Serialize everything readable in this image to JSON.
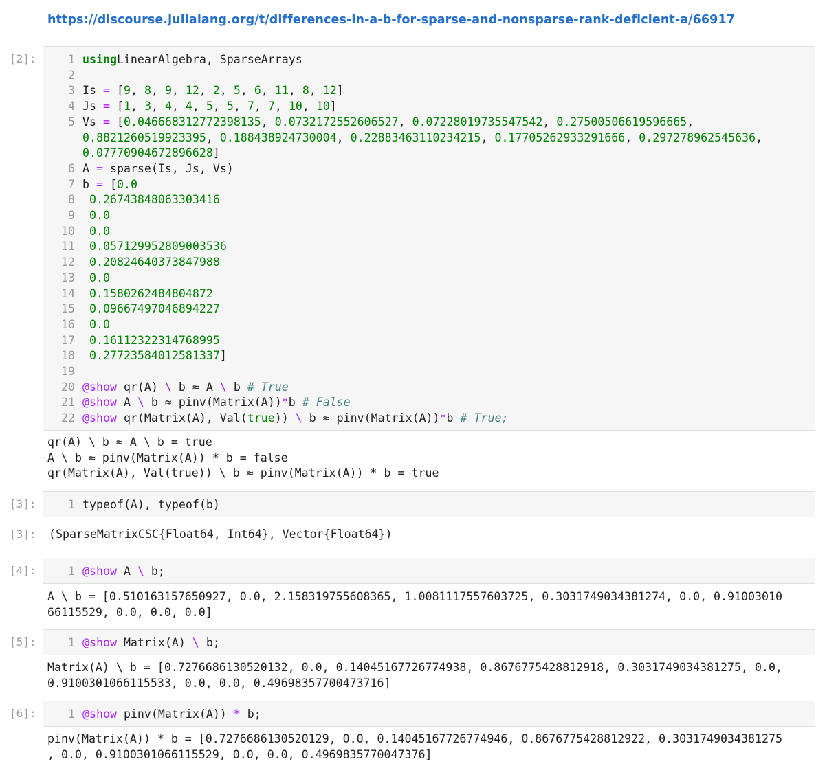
{
  "link": "https://discourse.julialang.org/t/differences-in-a-b-for-sparse-and-nonsparse-rank-deficient-a/66917",
  "cells": [
    {
      "prompt": "[2]:",
      "lines": [
        {
          "n": "1",
          "code": [
            [
              "kw",
              "using"
            ],
            [
              "",
              "LinearAlgebra, SparseArrays"
            ]
          ]
        },
        {
          "n": "2",
          "code": []
        },
        {
          "n": "3",
          "code": [
            [
              "",
              "Is "
            ],
            [
              "op",
              "="
            ],
            [
              "",
              " ["
            ],
            [
              "num",
              "9"
            ],
            [
              "",
              ", "
            ],
            [
              "num",
              "8"
            ],
            [
              "",
              ", "
            ],
            [
              "num",
              "9"
            ],
            [
              "",
              ", "
            ],
            [
              "num",
              "12"
            ],
            [
              "",
              ", "
            ],
            [
              "num",
              "2"
            ],
            [
              "",
              ", "
            ],
            [
              "num",
              "5"
            ],
            [
              "",
              ", "
            ],
            [
              "num",
              "6"
            ],
            [
              "",
              ", "
            ],
            [
              "num",
              "11"
            ],
            [
              "",
              ", "
            ],
            [
              "num",
              "8"
            ],
            [
              "",
              ", "
            ],
            [
              "num",
              "12"
            ],
            [
              "",
              "]"
            ]
          ]
        },
        {
          "n": "4",
          "code": [
            [
              "",
              "Js "
            ],
            [
              "op",
              "="
            ],
            [
              "",
              " ["
            ],
            [
              "num",
              "1"
            ],
            [
              "",
              ", "
            ],
            [
              "num",
              "3"
            ],
            [
              "",
              ", "
            ],
            [
              "num",
              "4"
            ],
            [
              "",
              ", "
            ],
            [
              "num",
              "4"
            ],
            [
              "",
              ", "
            ],
            [
              "num",
              "5"
            ],
            [
              "",
              ", "
            ],
            [
              "num",
              "5"
            ],
            [
              "",
              ", "
            ],
            [
              "num",
              "7"
            ],
            [
              "",
              ", "
            ],
            [
              "num",
              "7"
            ],
            [
              "",
              ", "
            ],
            [
              "num",
              "10"
            ],
            [
              "",
              ", "
            ],
            [
              "num",
              "10"
            ],
            [
              "",
              "]"
            ]
          ]
        },
        {
          "n": "5",
          "code": [
            [
              "",
              "Vs "
            ],
            [
              "op",
              "="
            ],
            [
              "",
              " ["
            ],
            [
              "num",
              "0.046668312772398135"
            ],
            [
              "",
              ", "
            ],
            [
              "num",
              "0.0732172552606527"
            ],
            [
              "",
              ", "
            ],
            [
              "num",
              "0.07228019735547542"
            ],
            [
              "",
              ", "
            ],
            [
              "num",
              "0.27500506619596665"
            ],
            [
              "",
              ","
            ]
          ]
        },
        {
          "n": "",
          "code": [
            [
              "num",
              "0.8821260519923395"
            ],
            [
              "",
              ", "
            ],
            [
              "num",
              "0.188438924730004"
            ],
            [
              "",
              ", "
            ],
            [
              "num",
              "0.22883463110234215"
            ],
            [
              "",
              ", "
            ],
            [
              "num",
              "0.17705262933291666"
            ],
            [
              "",
              ", "
            ],
            [
              "num",
              "0.297278962545636"
            ],
            [
              "",
              ","
            ]
          ]
        },
        {
          "n": "",
          "code": [
            [
              "num",
              "0.07770904672896628"
            ],
            [
              "",
              "]"
            ]
          ]
        },
        {
          "n": "6",
          "code": [
            [
              "",
              "A "
            ],
            [
              "op",
              "="
            ],
            [
              "",
              " sparse(Is, Js, Vs)"
            ]
          ]
        },
        {
          "n": "7",
          "code": [
            [
              "",
              "b "
            ],
            [
              "op",
              "="
            ],
            [
              "",
              " ["
            ],
            [
              "num",
              "0.0"
            ]
          ]
        },
        {
          "n": "8",
          "code": [
            [
              "",
              " "
            ],
            [
              "num",
              "0.26743848063303416"
            ]
          ]
        },
        {
          "n": "9",
          "code": [
            [
              "",
              " "
            ],
            [
              "num",
              "0.0"
            ]
          ]
        },
        {
          "n": "10",
          "code": [
            [
              "",
              " "
            ],
            [
              "num",
              "0.0"
            ]
          ]
        },
        {
          "n": "11",
          "code": [
            [
              "",
              " "
            ],
            [
              "num",
              "0.057129952809003536"
            ]
          ]
        },
        {
          "n": "12",
          "code": [
            [
              "",
              " "
            ],
            [
              "num",
              "0.20824640373847988"
            ]
          ]
        },
        {
          "n": "13",
          "code": [
            [
              "",
              " "
            ],
            [
              "num",
              "0.0"
            ]
          ]
        },
        {
          "n": "14",
          "code": [
            [
              "",
              " "
            ],
            [
              "num",
              "0.1580262484804872"
            ]
          ]
        },
        {
          "n": "15",
          "code": [
            [
              "",
              " "
            ],
            [
              "num",
              "0.09667497046894227"
            ]
          ]
        },
        {
          "n": "16",
          "code": [
            [
              "",
              " "
            ],
            [
              "num",
              "0.0"
            ]
          ]
        },
        {
          "n": "17",
          "code": [
            [
              "",
              " "
            ],
            [
              "num",
              "0.16112322314768995"
            ]
          ]
        },
        {
          "n": "18",
          "code": [
            [
              "",
              " "
            ],
            [
              "num",
              "0.27723584012581337"
            ],
            [
              "",
              "]"
            ]
          ]
        },
        {
          "n": "19",
          "code": []
        },
        {
          "n": "20",
          "code": [
            [
              "mac",
              "@show"
            ],
            [
              "",
              " qr(A) "
            ],
            [
              "op",
              "\\"
            ],
            [
              "",
              " b ≈ A "
            ],
            [
              "op",
              "\\"
            ],
            [
              "",
              " b "
            ],
            [
              "cmt",
              "# True"
            ]
          ]
        },
        {
          "n": "21",
          "code": [
            [
              "mac",
              "@show"
            ],
            [
              "",
              " A "
            ],
            [
              "op",
              "\\"
            ],
            [
              "",
              " b ≈ pinv(Matrix(A))"
            ],
            [
              "op",
              "*"
            ],
            [
              "",
              "b "
            ],
            [
              "cmt",
              "# False"
            ]
          ]
        },
        {
          "n": "22",
          "code": [
            [
              "mac",
              "@show"
            ],
            [
              "",
              " qr(Matrix(A), Val("
            ],
            [
              "num",
              "true"
            ],
            [
              "",
              "))"
            ],
            [
              "",
              " "
            ],
            [
              "op",
              "\\"
            ],
            [
              "",
              " b ≈ pinv(Matrix(A))"
            ],
            [
              "op",
              "*"
            ],
            [
              "",
              "b "
            ],
            [
              "cmt",
              "# True;"
            ]
          ]
        }
      ],
      "output": [
        "qr(A) \\ b ≈ A \\ b = true",
        "A \\ b ≈ pinv(Matrix(A)) * b = false",
        "qr(Matrix(A), Val(true)) \\ b ≈ pinv(Matrix(A)) * b = true"
      ]
    },
    {
      "prompt": "[3]:",
      "lines": [
        {
          "n": "1",
          "code": [
            [
              "",
              "typeof(A), typeof(b)"
            ]
          ]
        }
      ],
      "out_prompt": "[3]:",
      "output": [
        "(SparseMatrixCSC{Float64, Int64}, Vector{Float64})"
      ]
    },
    {
      "prompt": "[4]:",
      "lines": [
        {
          "n": "1",
          "code": [
            [
              "mac",
              "@show"
            ],
            [
              "",
              " A "
            ],
            [
              "op",
              "\\"
            ],
            [
              "",
              " b;"
            ]
          ]
        }
      ],
      "output": [
        "A \\ b = [0.510163157650927, 0.0, 2.158319755608365, 1.0081117557603725, 0.3031749034381274, 0.0, 0.91003010",
        "66115529, 0.0, 0.0, 0.0]"
      ]
    },
    {
      "prompt": "[5]:",
      "lines": [
        {
          "n": "1",
          "code": [
            [
              "mac",
              "@show"
            ],
            [
              "",
              " Matrix(A) "
            ],
            [
              "op",
              "\\"
            ],
            [
              "",
              " b;"
            ]
          ]
        }
      ],
      "output": [
        "Matrix(A) \\ b = [0.7276686130520132, 0.0, 0.14045167726774938, 0.8676775428812918, 0.3031749034381275, 0.0,",
        "0.9100301066115533, 0.0, 0.0, 0.49698357700473716]"
      ]
    },
    {
      "prompt": "[6]:",
      "lines": [
        {
          "n": "1",
          "code": [
            [
              "mac",
              "@show"
            ],
            [
              "",
              " pinv(Matrix(A)) "
            ],
            [
              "op",
              "*"
            ],
            [
              "",
              " b;"
            ]
          ]
        }
      ],
      "output": [
        "pinv(Matrix(A)) * b = [0.7276686130520129, 0.0, 0.14045167726774946, 0.8676775428812922, 0.3031749034381275",
        ", 0.0, 0.9100301066115529, 0.0, 0.0, 0.4969835770047376]"
      ]
    }
  ]
}
